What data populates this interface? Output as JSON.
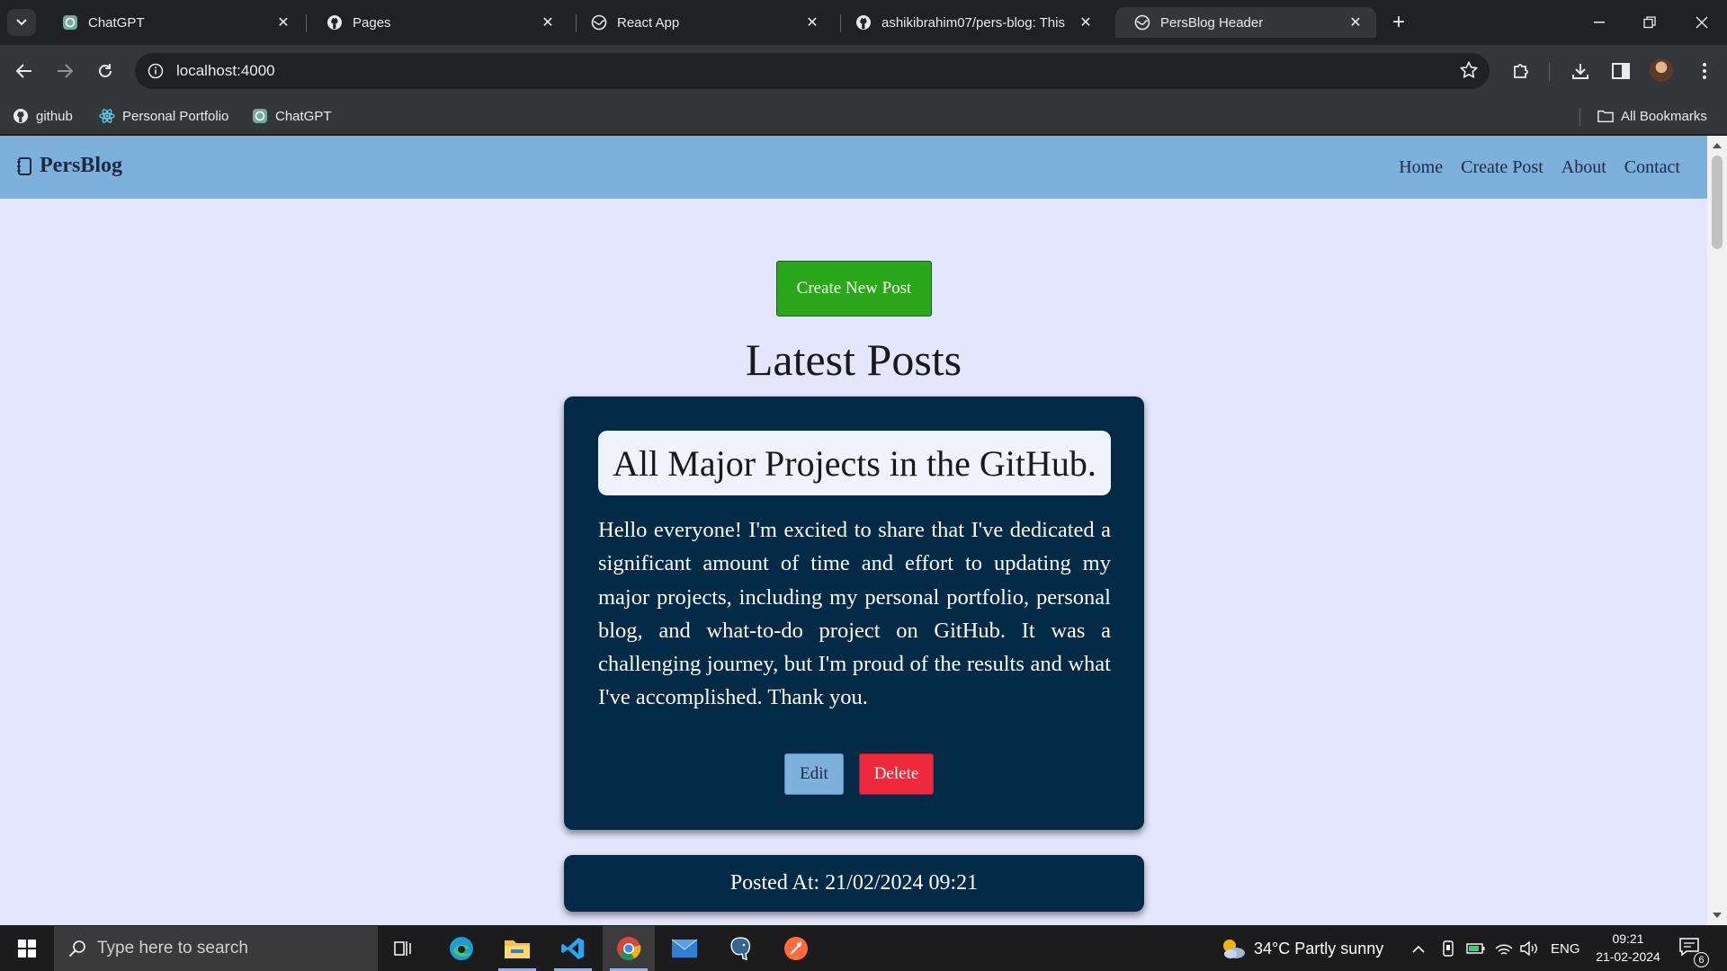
{
  "browser": {
    "tabs": [
      {
        "title": "ChatGPT",
        "icon": "chatgpt-icon",
        "active": false
      },
      {
        "title": "Pages",
        "icon": "github-icon",
        "active": false
      },
      {
        "title": "React App",
        "icon": "globe-icon",
        "active": false
      },
      {
        "title": "ashikibrahim07/pers-blog: This",
        "icon": "github-icon",
        "active": false
      },
      {
        "title": "PersBlog Header",
        "icon": "globe-icon",
        "active": true
      }
    ],
    "url": "localhost:4000",
    "bookmarks": [
      {
        "label": "github",
        "icon": "github-icon"
      },
      {
        "label": "Personal Portfolio",
        "icon": "react-icon"
      },
      {
        "label": "ChatGPT",
        "icon": "chatgpt-icon"
      }
    ],
    "all_bookmarks": "All Bookmarks"
  },
  "site": {
    "logo": "PersBlog",
    "nav": [
      "Home",
      "Create Post",
      "About",
      "Contact"
    ],
    "create_button": "Create New Post",
    "section_title": "Latest Posts",
    "post": {
      "title": "All Major Projects in the GitHub.",
      "body": "Hello everyone! I'm excited to share that I've dedicated a significant amount of time and effort to updating my major projects, including my personal portfolio, personal blog, and what-to-do project on GitHub. It was a challenging journey, but I'm proud of the results and what I've accomplished. Thank you.",
      "edit_label": "Edit",
      "delete_label": "Delete"
    },
    "posted_at": "Posted At: 21/02/2024 09:21",
    "colors": {
      "header": "#7db0db",
      "background": "#e3e6fc",
      "card": "#032a47",
      "create_button": "#2aa81a",
      "delete_button": "#f0283c"
    }
  },
  "taskbar": {
    "search_placeholder": "Type here to search",
    "weather": "34°C  Partly sunny",
    "language": "ENG",
    "time": "09:21",
    "date": "21-02-2024",
    "notification_count": "6"
  }
}
